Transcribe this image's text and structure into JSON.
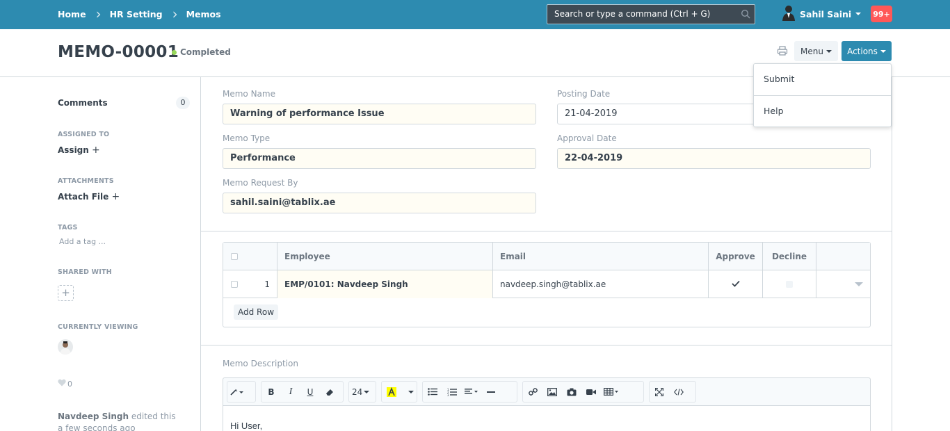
{
  "navbar": {
    "breadcrumbs": [
      "Home",
      "HR Setting",
      "Memos"
    ],
    "search_placeholder": "Search or type a command (Ctrl + G)",
    "user_name": "Sahil Saini",
    "notifications": "99+"
  },
  "page": {
    "title": "MEMO-00001",
    "status": "Completed",
    "menu_label": "Menu",
    "actions_label": "Actions"
  },
  "actions_dropdown": [
    "Submit",
    "Help"
  ],
  "sidebar": {
    "comments_label": "Comments",
    "comments_count": "0",
    "assigned_to_label": "ASSIGNED TO",
    "assign_link": "Assign",
    "attachments_label": "ATTACHMENTS",
    "attach_link": "Attach File",
    "tags_label": "TAGS",
    "tag_placeholder": "Add a tag ...",
    "shared_with_label": "SHARED WITH",
    "currently_viewing_label": "CURRENTLY VIEWING",
    "likes": "0",
    "activity_user": "Navdeep Singh",
    "activity_text": "edited this",
    "activity_time": "a few seconds ago"
  },
  "form": {
    "memo_name_label": "Memo Name",
    "memo_name": "Warning of performance Issue",
    "posting_date_label": "Posting Date",
    "posting_date": "21-04-2019",
    "memo_type_label": "Memo Type",
    "memo_type": "Performance",
    "approval_date_label": "Approval Date",
    "approval_date": "22-04-2019",
    "memo_request_by_label": "Memo Request By",
    "memo_request_by": "sahil.saini@tablix.ae"
  },
  "table": {
    "headers": [
      "Employee",
      "Email",
      "Approve",
      "Decline"
    ],
    "rows": [
      {
        "idx": "1",
        "employee": "EMP/0101: Navdeep Singh",
        "email": "navdeep.singh@tablix.ae"
      }
    ],
    "add_row_label": "Add Row"
  },
  "description": {
    "label": "Memo Description",
    "font_size": "24",
    "content": "Hi User,"
  },
  "colors": {
    "navbar": "#2d8bb0",
    "status_dot": "#98d85b",
    "notification": "#ff5858"
  }
}
